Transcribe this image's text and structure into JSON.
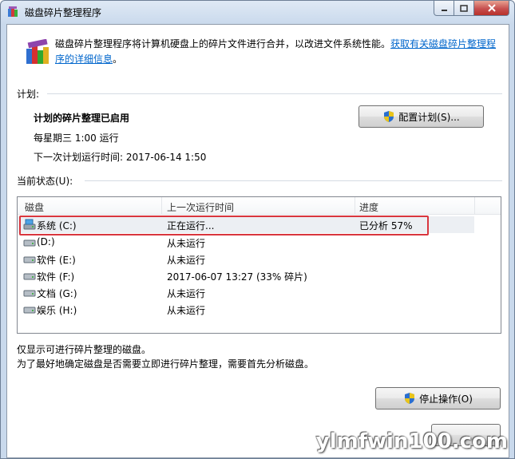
{
  "window": {
    "title": "磁盘碎片整理程序",
    "controls": {
      "minimize": "▭",
      "maximize": "□",
      "close": "✕"
    }
  },
  "description": {
    "text": "磁盘碎片整理程序将计算机硬盘上的碎片文件进行合并，以改进文件系统性能。",
    "link": "获取有关磁盘碎片整理程序的详细信息",
    "suffix": "。"
  },
  "schedule": {
    "section_label": "计划:",
    "status_title": "计划的碎片整理已启用",
    "frequency": "每星期三  1:00 运行",
    "next_run": "下一次计划运行时间: 2017-06-14 1:50",
    "configure_button": "配置计划(S)..."
  },
  "current_status": {
    "section_label": "当前状态(U):",
    "columns": [
      "磁盘",
      "上一次运行时间",
      "进度"
    ],
    "rows": [
      {
        "disk": "系统 (C:)",
        "last_run": "正在运行...",
        "progress": "已分析 57%",
        "icon": "system-drive-icon"
      },
      {
        "disk": "(D:)",
        "last_run": "从未运行",
        "progress": "",
        "icon": "drive-icon"
      },
      {
        "disk": "软件 (E:)",
        "last_run": "从未运行",
        "progress": "",
        "icon": "drive-icon"
      },
      {
        "disk": "软件 (F:)",
        "last_run": "2017-06-07 13:27 (33% 碎片)",
        "progress": "",
        "icon": "drive-icon"
      },
      {
        "disk": "文档 (G:)",
        "last_run": "从未运行",
        "progress": "",
        "icon": "drive-icon"
      },
      {
        "disk": "娱乐 (H:)",
        "last_run": "从未运行",
        "progress": "",
        "icon": "drive-icon"
      }
    ]
  },
  "notes": {
    "line1": "仅显示可进行碎片整理的磁盘。",
    "line2": "为了最好地确定磁盘是否需要立即进行碎片整理，需要首先分析磁盘。"
  },
  "actions": {
    "stop_button": "停止操作(O)"
  },
  "watermark": "ylmfwin100.com",
  "colors": {
    "link": "#0066cc",
    "highlight_box": "#d9363e",
    "close_button": "#c75050"
  }
}
